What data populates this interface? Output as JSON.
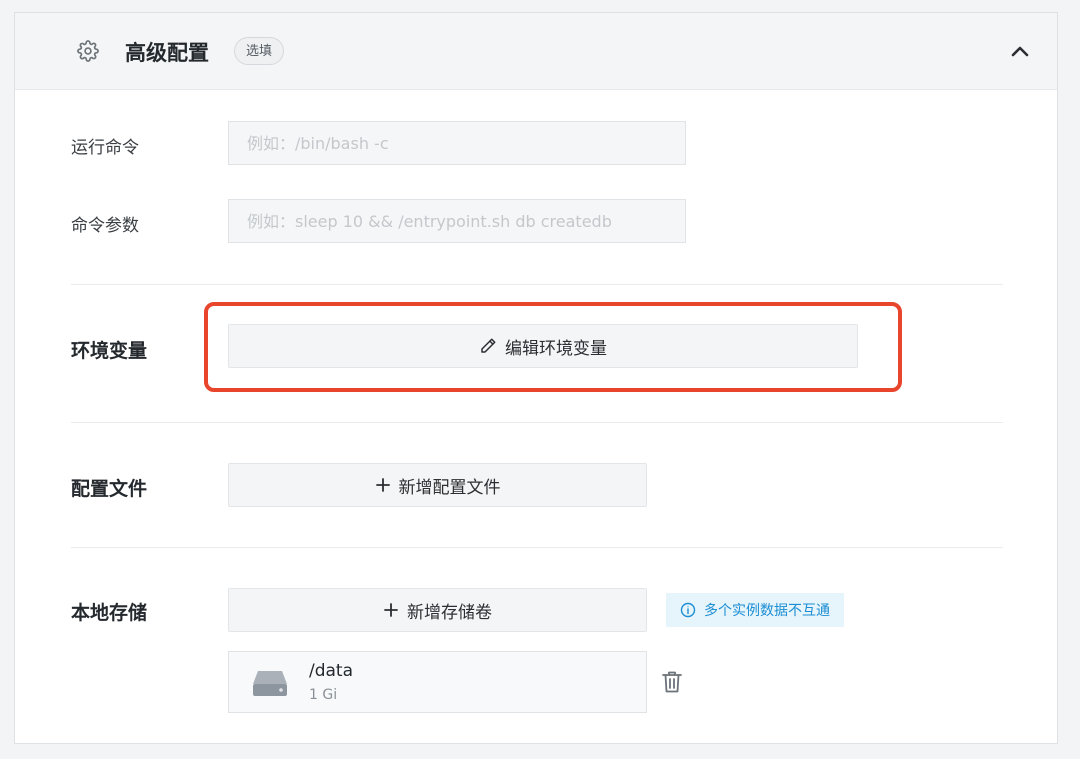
{
  "header": {
    "title": "高级配置",
    "badge": "选填",
    "icons": {
      "settings": "gear-icon",
      "collapse": "chevron-up-icon"
    }
  },
  "command": {
    "label": "运行命令",
    "placeholder": "例如：/bin/bash -c",
    "value": ""
  },
  "args": {
    "label": "命令参数",
    "placeholder": "例如：sleep 10 && /entrypoint.sh db createdb",
    "value": ""
  },
  "env": {
    "label": "环境变量",
    "button_label": "编辑环境变量",
    "button_icon": "pencil-icon",
    "highlight_color": "#e8452c"
  },
  "config_files": {
    "label": "配置文件",
    "button_label": "新增配置文件",
    "button_icon": "plus-icon"
  },
  "storage": {
    "label": "本地存储",
    "button_label": "新增存储卷",
    "button_icon": "plus-icon",
    "notice": "多个实例数据不互通",
    "notice_icon": "info-icon",
    "volumes": [
      {
        "path": "/data",
        "size": "1 Gi",
        "icon": "hard-disk-icon",
        "action_icon": "trash-icon"
      }
    ]
  }
}
